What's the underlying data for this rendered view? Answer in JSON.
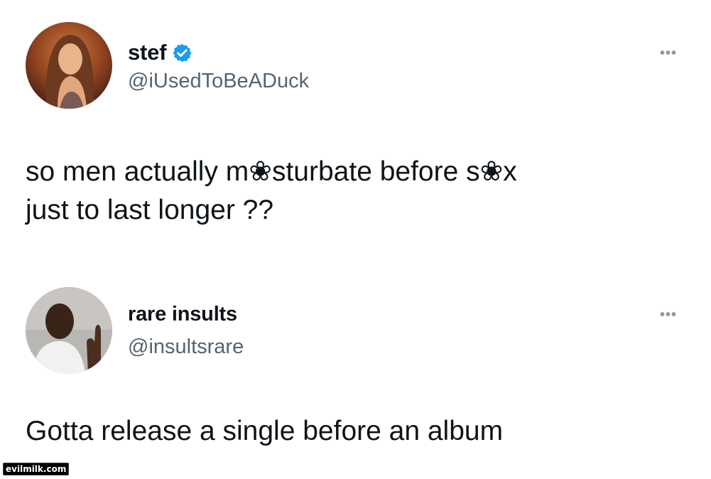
{
  "tweets": [
    {
      "display_name": "stef",
      "verified": true,
      "handle": "@iUsedToBeADuck",
      "more_icon": "more-horizontal-icon",
      "text_line1": "so men actually m❀sturbate before s❀x",
      "text_line2": "just to last longer ??"
    },
    {
      "display_name": "rare insults",
      "verified": false,
      "handle": "@insultsrare",
      "more_icon": "more-horizontal-icon",
      "text_line1": "Gotta release a single before an album"
    }
  ],
  "watermark": "evilmilk.com",
  "colors": {
    "text": "#0f1419",
    "handle": "#536471",
    "verified": "#1d9bf0"
  }
}
